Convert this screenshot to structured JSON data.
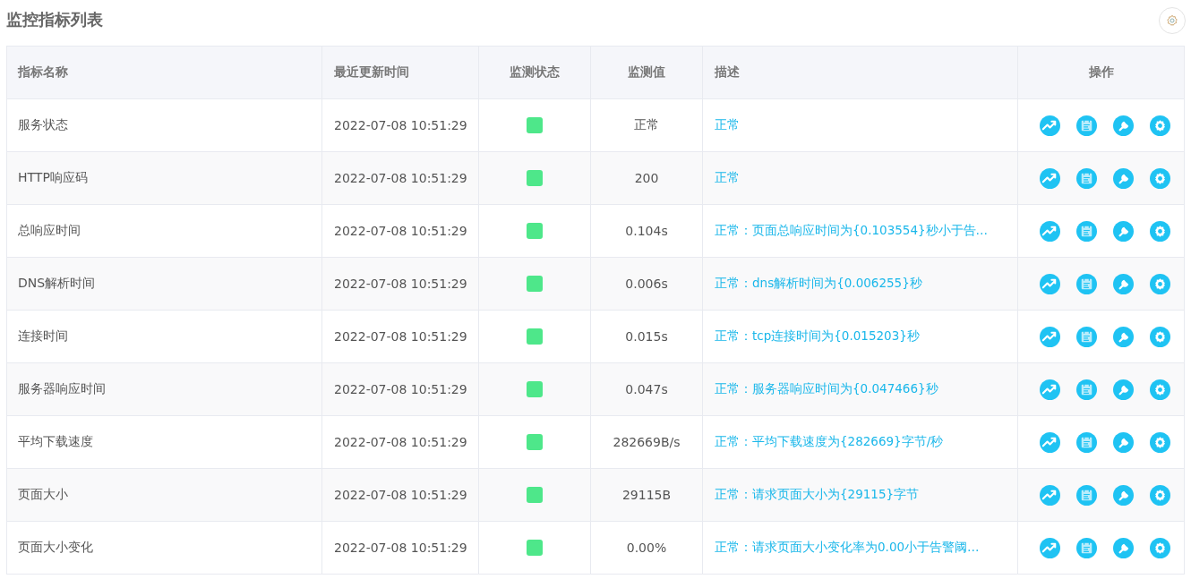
{
  "title": "监控指标列表",
  "table": {
    "columns": [
      "指标名称",
      "最近更新时间",
      "监测状态",
      "监测值",
      "描述",
      "操作"
    ],
    "rows": [
      {
        "name": "服务状态",
        "time": "2022-07-08 10:51:29",
        "color": "#4ee78a",
        "value": "正常",
        "description": "正常"
      },
      {
        "name": "HTTP响应码",
        "time": "2022-07-08 10:51:29",
        "color": "#4ee78a",
        "value": "200",
        "description": "正常"
      },
      {
        "name": "总响应时间",
        "time": "2022-07-08 10:51:29",
        "color": "#4ee78a",
        "value": "0.104s",
        "description": "正常：页面总响应时间为{0.103554}秒小于告…"
      },
      {
        "name": "DNS解析时间",
        "time": "2022-07-08 10:51:29",
        "color": "#4ee78a",
        "value": "0.006s",
        "description": "正常：dns解析时间为{0.006255}秒"
      },
      {
        "name": "连接时间",
        "time": "2022-07-08 10:51:29",
        "color": "#4ee78a",
        "value": "0.015s",
        "description": "正常：tcp连接时间为{0.015203}秒"
      },
      {
        "name": "服务器响应时间",
        "time": "2022-07-08 10:51:29",
        "color": "#4ee78a",
        "value": "0.047s",
        "description": "正常：服务器响应时间为{0.047466}秒"
      },
      {
        "name": "平均下载速度",
        "time": "2022-07-08 10:51:29",
        "color": "#4ee78a",
        "value": "282669B/s",
        "description": "正常：平均下载速度为{282669}字节/秒"
      },
      {
        "name": "页面大小",
        "time": "2022-07-08 10:51:29",
        "color": "#4ee78a",
        "value": "29115B",
        "description": "正常：请求页面大小为{29115}字节"
      },
      {
        "name": "页面大小变化",
        "time": "2022-07-08 10:51:29",
        "color": "#4ee78a",
        "value": "0.00%",
        "description": "正常：请求页面大小变化率为0.00小于告警阈…"
      }
    ]
  }
}
